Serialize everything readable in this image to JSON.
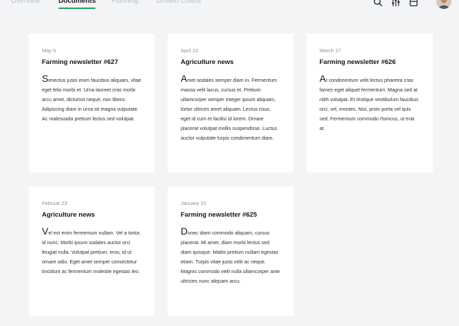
{
  "theme": {
    "accent": "#22a05a",
    "background": "#f3f4f6",
    "card_background": "#ffffff"
  },
  "nav": {
    "tabs": [
      {
        "label": "Overview",
        "active": false
      },
      {
        "label": "Documents",
        "active": true
      },
      {
        "label": "Planning",
        "active": false
      },
      {
        "label": "Growth Charts",
        "active": false
      }
    ],
    "icons": [
      "search-icon",
      "filter-icon",
      "calendar-icon",
      "avatar"
    ]
  },
  "cards": [
    {
      "date": "May 5",
      "title": "Farming newsletter #627",
      "initial": "S",
      "body": "enectus justo enim faucibus aliquam, vitae eget felis morbi et. Urna laoreet cras morbi arcu amet, dictumst neque, non libero. Adipiscing diam in urna sit magna vulputate. Ac malesuada pretium lectus sed volutpat."
    },
    {
      "date": "April 23",
      "title": "Agriculture news",
      "initial": "A",
      "body": "met sodales semper diam in. Fermentum massa velit lacus, cursus et. Pretium ullamcorper semper integer ipsum aliquam, tortor ultrices amet aliquam. Lectus risus, eget id cum et facilisi id lorem. Ornare placerat volutpat mollis suspendisse. Luctus auctor vulputate turpis condimentum diam."
    },
    {
      "date": "March 17",
      "title": "Farming newsletter #626",
      "initial": "A",
      "body": "t condimentum velit lectus pharetra cras fames eget aliquet fermentum. Magna sed at nibh volutpat. Et tristique vestibulum faucibus orci, vel, montes. Nisi, proin porta vel quis sed. Fermentum commodo rhoncus, ut erat at."
    },
    {
      "date": "Februar 23",
      "title": "Agriculture news",
      "initial": "V",
      "body": "el est enim fermentum nullam. Vel a tortor, id nunc. Morbi ipsum sodales auctor orci feugiat nulla. Volutpat pretium, eros, id ut ornare odio. Eget amet semper consectetur tincidunt ac fermentum molestie egestas leo."
    },
    {
      "date": "January 15",
      "title": "Farming newsletter #625",
      "initial": "D",
      "body": "onec diam commodo aliquam, cursus placerat. Mi amet, diam morbi lectus sed diam quisque. Mattis pretium nullam egestas etiam. Turpis vitae justo velit ac neque. Magnis commodo velit nulla ullamcorper ante ultricies nunc aliquam arcu."
    }
  ]
}
